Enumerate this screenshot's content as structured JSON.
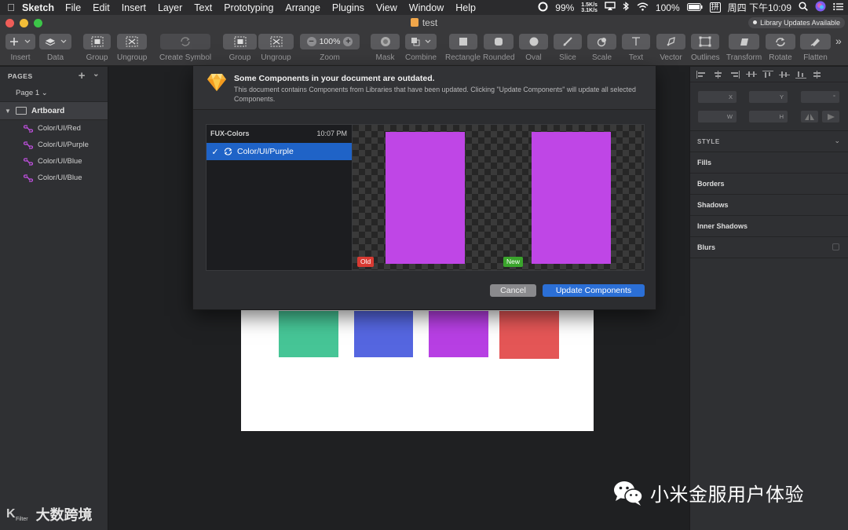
{
  "menubar": {
    "app_name": "Sketch",
    "items": [
      "File",
      "Edit",
      "Insert",
      "Layer",
      "Text",
      "Prototyping",
      "Arrange",
      "Plugins",
      "View",
      "Window",
      "Help"
    ],
    "battery_pct": "99%",
    "net_up": "1.5K/s",
    "net_down": "3.1K/s",
    "battery2": "100%",
    "input_method": "拼",
    "clock": "周四 下午10:09"
  },
  "window": {
    "title": "test",
    "library_badge": "Library Updates Available"
  },
  "toolbar": {
    "insert": "Insert",
    "data": "Data",
    "group": "Group",
    "ungroup": "Ungroup",
    "create_symbol": "Create Symbol",
    "group2": "Group",
    "ungroup2": "Ungroup",
    "zoom_label": "Zoom",
    "zoom_value": "100%",
    "mask": "Mask",
    "combine": "Combine",
    "rectangle": "Rectangle",
    "rounded": "Rounded",
    "oval": "Oval",
    "slice": "Slice",
    "scale": "Scale",
    "text": "Text",
    "vector": "Vector",
    "outlines": "Outlines",
    "transform": "Transform",
    "rotate": "Rotate",
    "flatten": "Flatten",
    "more": "»"
  },
  "sidebar": {
    "pages_header": "PAGES",
    "page": "Page 1 ⌄",
    "artboard": "Artboard",
    "layers": [
      "Color/UI/Red",
      "Color/UI/Purple",
      "Color/UI/Blue",
      "Color/UI/Blue"
    ]
  },
  "inspector": {
    "x": "X",
    "y": "Y",
    "rot": "°",
    "w": "W",
    "h": "H",
    "style_header": "STYLE",
    "sections": [
      "Fills",
      "Borders",
      "Shadows",
      "Inner Shadows",
      "Blurs"
    ]
  },
  "dialog": {
    "title": "Some Components in your document are outdated.",
    "message": "This document contains Components from Libraries that have been updated. Clicking \"Update Components\" will update all selected Components.",
    "library_name": "FUX-Colors",
    "library_time": "10:07 PM",
    "component": "Color/UI/Purple",
    "check": "✓",
    "old_label": "Old",
    "new_label": "New",
    "cancel": "Cancel",
    "update": "Update Components"
  },
  "colors": {
    "green": "#46c596",
    "blue": "#5566e0",
    "purple": "#b73fe3",
    "red": "#e45656",
    "preview_purple": "#bf46e6",
    "accent_blue": "#2b6fd6",
    "old_tag": "#d83a32",
    "new_tag": "#3aa52c"
  },
  "watermark": {
    "left_logo": "K",
    "left_sub": "Filter",
    "left_text": "大数跨境",
    "right_text": "小米金服用户体验"
  }
}
